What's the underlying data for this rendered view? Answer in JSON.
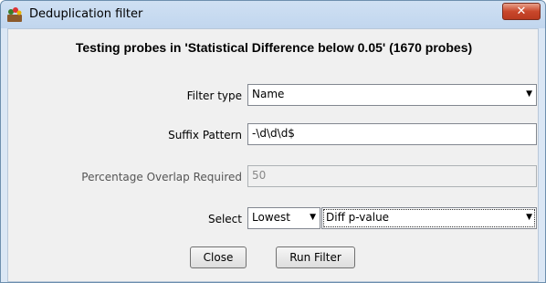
{
  "window": {
    "title": "Deduplication filter",
    "close_glyph": "✕"
  },
  "heading": "Testing probes in 'Statistical Difference below 0.05' (1670 probes)",
  "fields": {
    "filter_type": {
      "label": "Filter type",
      "value": "Name"
    },
    "suffix_pattern": {
      "label": "Suffix Pattern",
      "value": "-\\d\\d\\d$"
    },
    "percentage_overlap": {
      "label": "Percentage Overlap Required",
      "value": "50"
    },
    "select": {
      "label": "Select",
      "mode_value": "Lowest",
      "field_value": "Diff p-value"
    }
  },
  "buttons": {
    "close_label": "Close",
    "run_label": "Run Filter"
  },
  "colors": {
    "accent": "#c9472b",
    "title_bar": "#c1d6ee"
  },
  "icons": {
    "app": "seqmonk-app-icon",
    "dropdown": "chevron-down-icon"
  }
}
